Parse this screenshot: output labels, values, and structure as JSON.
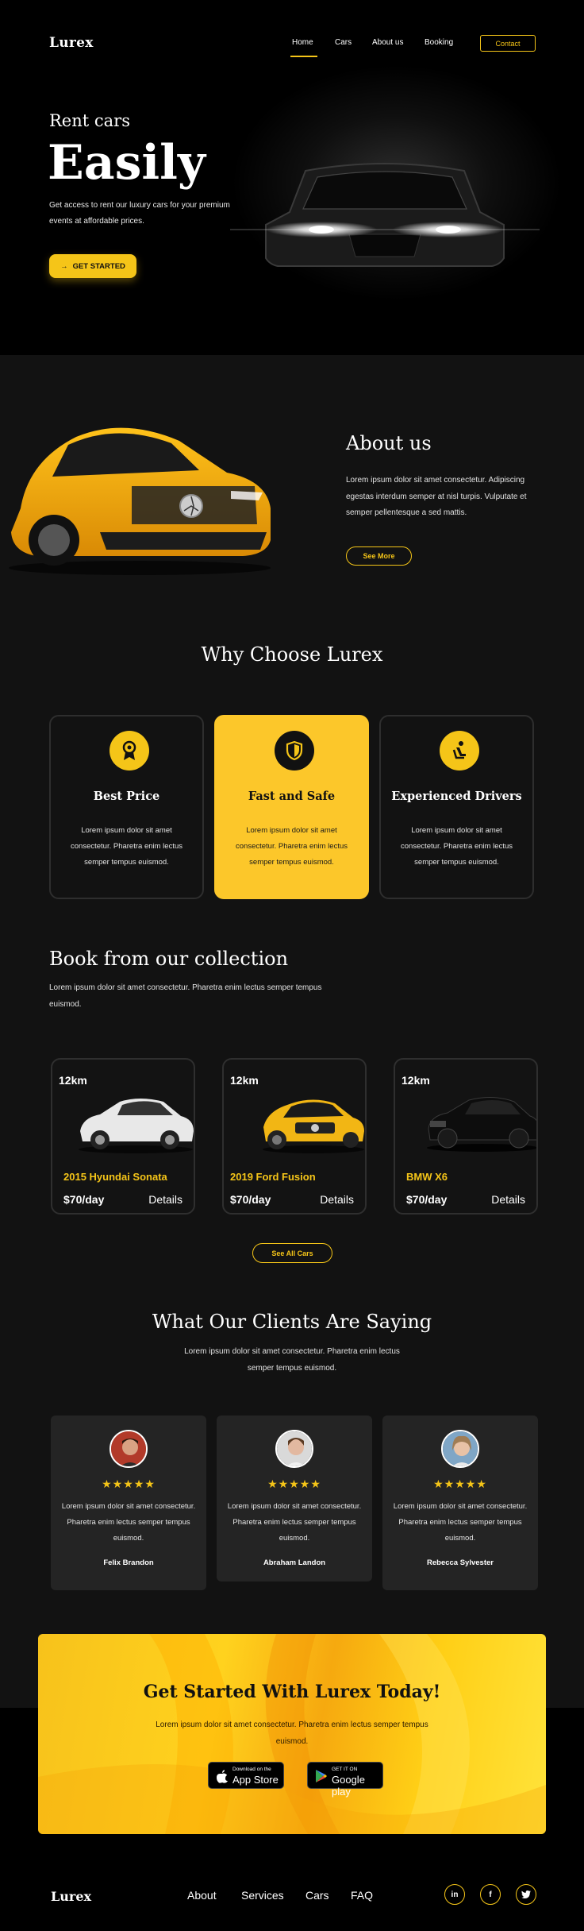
{
  "header": {
    "logo": "Lurex",
    "nav": [
      "Home",
      "Cars",
      "About us",
      "Booking"
    ],
    "contact_label": "Contact"
  },
  "hero": {
    "subtitle": "Rent cars",
    "title": "Easily",
    "description": "Get access to rent our luxury cars for your premium events at affordable prices.",
    "cta_label": "GET STARTED"
  },
  "about": {
    "title": "About us",
    "description": "Lorem ipsum dolor sit amet consectetur. Adipiscing egestas interdum semper at nisl turpis. Vulputate et semper pellentesque a sed mattis.",
    "button_label": "See More"
  },
  "why": {
    "title": "Why Choose Lurex",
    "features": [
      {
        "icon": "price-medal-icon",
        "title": "Best Price",
        "description": "Lorem ipsum dolor sit amet consectetur. Pharetra enim lectus semper tempus euismod."
      },
      {
        "icon": "shield-icon",
        "title": "Fast and Safe",
        "description": "Lorem ipsum dolor sit amet consectetur. Pharetra enim lectus semper tempus euismod."
      },
      {
        "icon": "driver-seat-icon",
        "title": "Experienced Drivers",
        "description": "Lorem ipsum dolor sit amet consectetur. Pharetra enim lectus semper tempus euismod."
      }
    ]
  },
  "collection": {
    "title": "Book from our collection",
    "description": "Lorem ipsum dolor sit amet consectetur. Pharetra enim lectus semper tempus euismod.",
    "cars": [
      {
        "km": "12km",
        "name": "2015 Hyundai Sonata",
        "price": "$70/day",
        "details": "Details",
        "color": "#e8e8e8"
      },
      {
        "km": "12km",
        "name": "2019 Ford Fusion",
        "price": "$70/day",
        "details": "Details",
        "color": "#f2b614"
      },
      {
        "km": "12km",
        "name": "BMW X6",
        "price": "$70/day",
        "details": "Details",
        "color": "#0d0d0d"
      }
    ],
    "see_all_label": "See All Cars"
  },
  "testimonials": {
    "title": "What Our Clients Are Saying",
    "description": "Lorem ipsum dolor sit amet consectetur. Pharetra enim lectus semper tempus euismod.",
    "items": [
      {
        "name": "Felix Brandon",
        "stars": "★★★★★",
        "quote": "Lorem ipsum dolor sit amet consectetur. Pharetra enim lectus semper tempus euismod."
      },
      {
        "name": "Abraham Landon",
        "stars": "★★★★★",
        "quote": "Lorem ipsum dolor sit amet consectetur. Pharetra enim lectus semper tempus euismod."
      },
      {
        "name": "Rebecca Sylvester",
        "stars": "★★★★★",
        "quote": "Lorem ipsum dolor sit amet consectetur. Pharetra enim lectus semper tempus euismod."
      }
    ]
  },
  "cta": {
    "title": "Get Started With Lurex Today!",
    "description": "Lorem ipsum dolor sit amet consectetur. Pharetra enim lectus semper tempus euismod.",
    "app_store": {
      "small": "Download on the",
      "big": "App Store"
    },
    "google_play": {
      "small": "GET IT ON",
      "big": "Google play"
    }
  },
  "footer": {
    "logo": "Lurex",
    "links": [
      "About",
      "Services",
      "Cars",
      "FAQ"
    ],
    "social": [
      "in",
      "f",
      "t"
    ]
  },
  "colors": {
    "accent": "#f5c518",
    "background": "#121212",
    "hero_bg": "#000000"
  }
}
